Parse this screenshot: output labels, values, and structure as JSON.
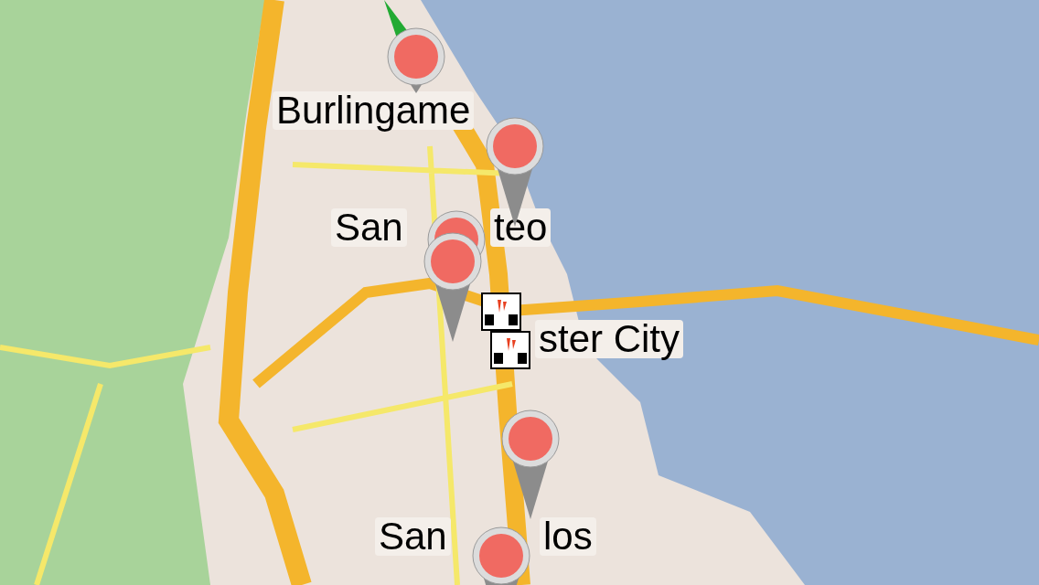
{
  "map": {
    "labels": [
      {
        "text": "Burlingame"
      },
      {
        "text": "San"
      },
      {
        "text": "teo"
      },
      {
        "text": "ster City"
      },
      {
        "text": "San"
      },
      {
        "text": "los"
      }
    ]
  }
}
